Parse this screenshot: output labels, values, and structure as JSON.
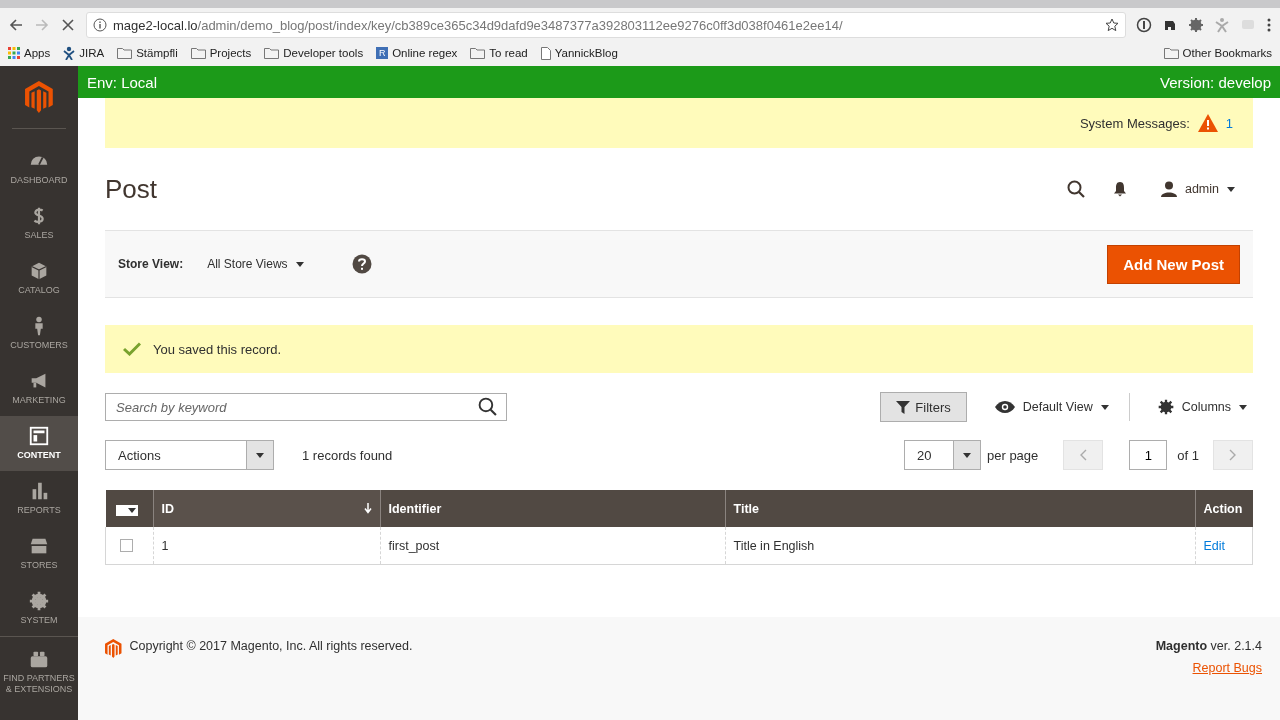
{
  "browser": {
    "url_host": "mage2-local.lo",
    "url_path": "/admin/demo_blog/post/index/key/cb389ce365c34d9dafd9e3487377a392803112ee9276c0ff3d038f0461e2ee14/",
    "bookmarks": [
      {
        "label": "Apps",
        "kind": "apps"
      },
      {
        "label": "JIRA",
        "kind": "jira"
      },
      {
        "label": "Stämpfli",
        "kind": "folder"
      },
      {
        "label": "Projects",
        "kind": "folder"
      },
      {
        "label": "Developer tools",
        "kind": "folder"
      },
      {
        "label": "Online regex",
        "kind": "letter",
        "letter": "R"
      },
      {
        "label": "To read",
        "kind": "folder"
      },
      {
        "label": "YannickBlog",
        "kind": "page"
      }
    ],
    "other_bookmarks": "Other Bookmarks"
  },
  "env_bar": {
    "left": "Env: Local",
    "right": "Version: develop"
  },
  "sidebar": {
    "items": [
      {
        "label": "DASHBOARD",
        "kind": "dashboard",
        "selected": false
      },
      {
        "label": "SALES",
        "kind": "dollar",
        "selected": false
      },
      {
        "label": "CATALOG",
        "kind": "box",
        "selected": false
      },
      {
        "label": "CUSTOMERS",
        "kind": "person",
        "selected": false
      },
      {
        "label": "MARKETING",
        "kind": "megaphone",
        "selected": false
      },
      {
        "label": "CONTENT",
        "kind": "layout",
        "selected": true
      },
      {
        "label": "REPORTS",
        "kind": "bars",
        "selected": false
      },
      {
        "label": "STORES",
        "kind": "store",
        "selected": false
      },
      {
        "label": "SYSTEM",
        "kind": "gear",
        "selected": false
      },
      {
        "label": "FIND PARTNERS & EXTENSIONS",
        "kind": "blocks",
        "selected": false
      }
    ]
  },
  "system_messages": {
    "label": "System Messages:",
    "count": "1"
  },
  "page_title": "Post",
  "user": "admin",
  "store_view": {
    "label": "Store View:",
    "value": "All Store Views"
  },
  "add_button": "Add New Post",
  "message": "You saved this record.",
  "search": {
    "placeholder": "Search by keyword"
  },
  "filters": "Filters",
  "view": "Default View",
  "columns_button": "Columns",
  "actions": "Actions",
  "records": "1 records found",
  "per_page": {
    "value": "20",
    "label": "per page"
  },
  "pager": {
    "page": "1",
    "of": "of 1"
  },
  "table": {
    "columns": [
      {
        "label": "ID",
        "sorted": true
      },
      {
        "label": "Identifier",
        "sorted": false
      },
      {
        "label": "Title",
        "sorted": false
      },
      {
        "label": "Action",
        "sorted": false
      }
    ],
    "rows": [
      {
        "checked": false,
        "cells": [
          "1",
          "first_post",
          "Title in English"
        ],
        "action": "Edit"
      }
    ]
  },
  "footer": {
    "copyright": "Copyright © 2017 Magento, Inc. All rights reserved.",
    "brand": "Magento",
    "version": "ver. 2.1.4",
    "report": "Report Bugs"
  }
}
